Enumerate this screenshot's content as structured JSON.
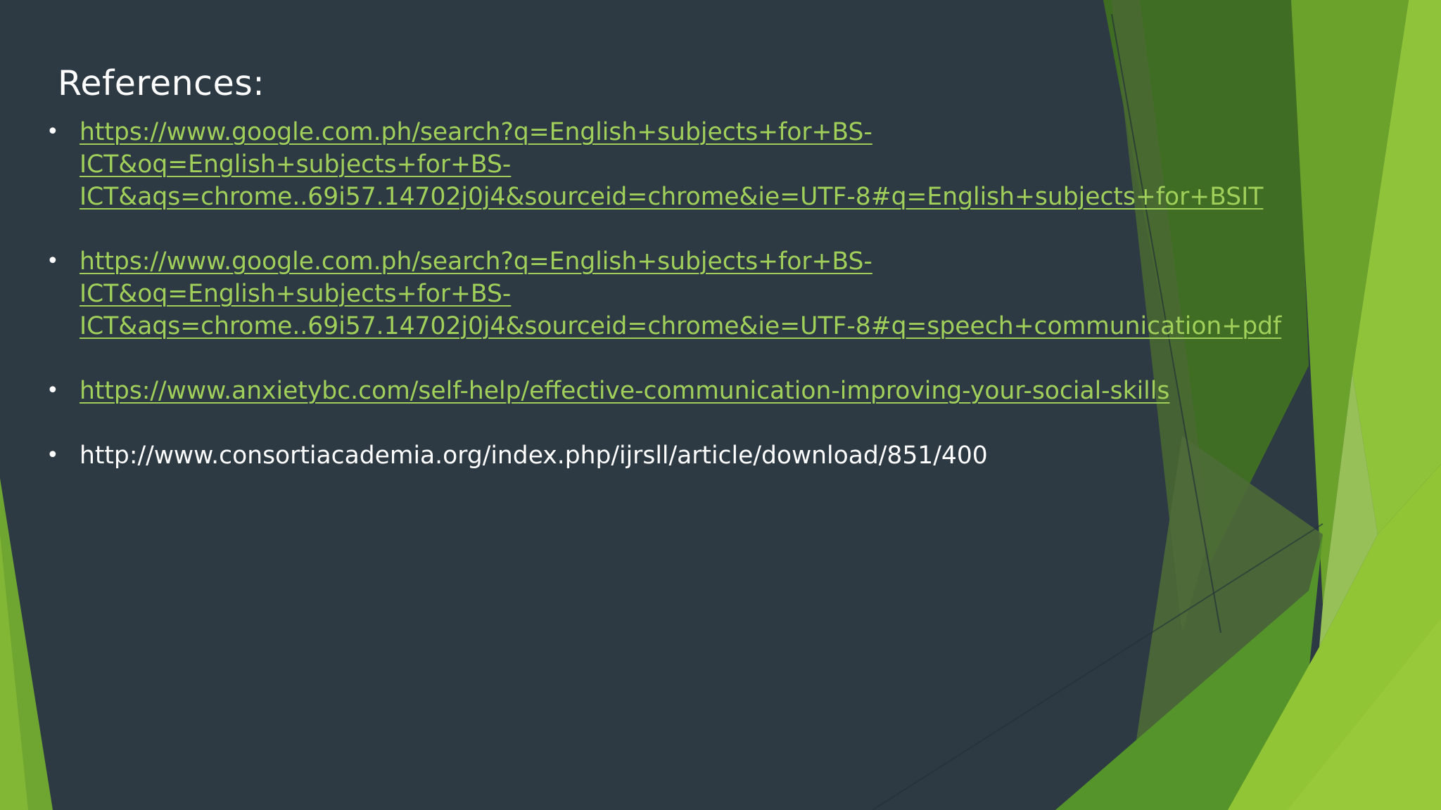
{
  "slide": {
    "title": "References:",
    "references": [
      {
        "line1": "https://www.google.com.ph/search?q=English+subjects+for+BS-ICT&oq=English+subjects+for+BS-",
        "line2": "ICT&aqs=chrome..69i57.14702j0j4&sourceid=chrome&ie=UTF-8#q=English+subjects+for+BSIT",
        "hyperlink": true
      },
      {
        "line1": "https://www.google.com.ph/search?q=English+subjects+for+BS-ICT&oq=English+subjects+for+BS-",
        "line2": "ICT&aqs=chrome..69i57.14702j0j4&sourceid=chrome&ie=UTF-8#q=speech+communication+pdf",
        "hyperlink": true
      },
      {
        "line1": "https://www.anxietybc.com/self-help/effective-communication-improving-your-social-skills",
        "hyperlink": true
      },
      {
        "line1": "http://www.consortiacademia.org/index.php/ijrsll/article/download/851/400",
        "hyperlink": false
      }
    ],
    "bullet_glyph": "•"
  },
  "colors": {
    "background": "#2d3a44",
    "link": "#a1d05a",
    "title": "#ffffff",
    "plain_text": "#ffffff",
    "accent_green_dark": "#3e6b22",
    "accent_green_mid": "#5b9a2a",
    "accent_green_light": "#94c63a"
  }
}
